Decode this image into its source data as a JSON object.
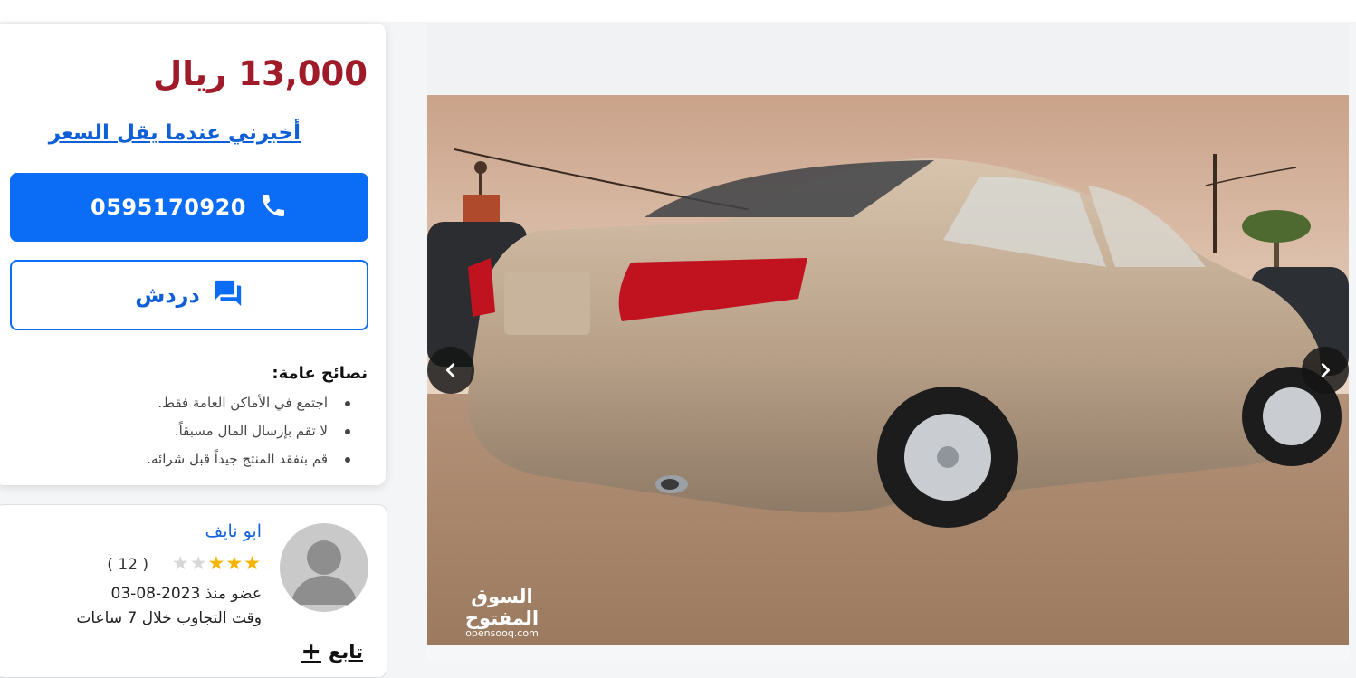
{
  "listing": {
    "price": "13,000 ريال",
    "notify_link": "أخبرني عندما يقل السعر",
    "phone": "0595170920",
    "chat_label": "دردش"
  },
  "tips": {
    "title": "نصائح عامة:",
    "items": [
      "اجتمع في الأماكن العامة فقط.",
      "لا تقم بإرسال المال مسبقاً.",
      "قم بتفقد المنتج جيداً قبل شرائه."
    ]
  },
  "seller": {
    "name": "ابو نايف",
    "rating": 3,
    "rating_max": 5,
    "reviews": "( 12 )",
    "member_since": "عضو منذ 2023-08-03",
    "response_time": "وقت التجاوب خلال 7 ساعات",
    "follow_label": "تابع"
  },
  "gallery": {
    "watermark_ar": "السوق المفتوح",
    "watermark_en": "opensooq.com"
  },
  "colors": {
    "price": "#a01b2a",
    "primary": "#0b6cf5",
    "link": "#0f5fd7",
    "star": "#f5b400"
  },
  "icons": [
    "phone-icon",
    "chat-icon",
    "chevron-left-icon",
    "chevron-right-icon",
    "plus-icon",
    "avatar-icon"
  ]
}
